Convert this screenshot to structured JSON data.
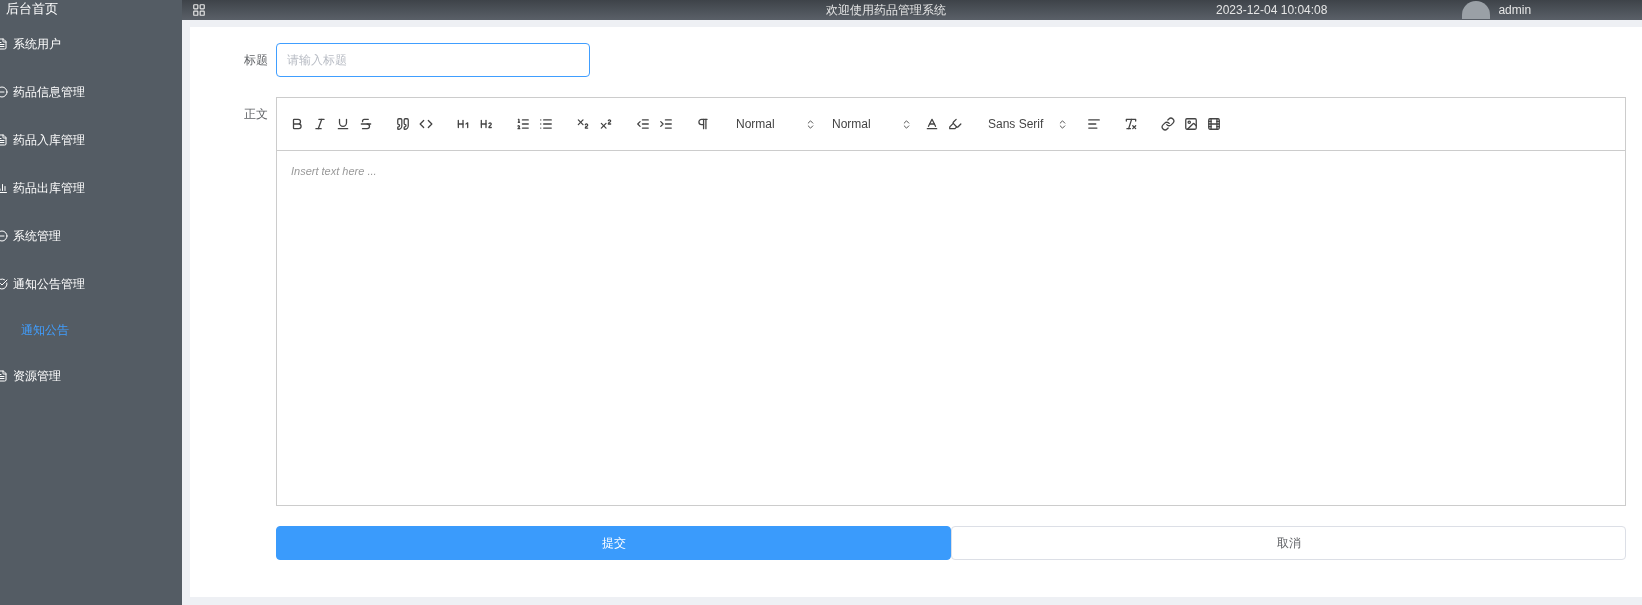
{
  "header": {
    "home": "后台首页",
    "welcome": "欢迎使用药品管理系统",
    "datetime": "2023-12-04 10:04:08",
    "user": "admin"
  },
  "sidebar": {
    "items": [
      {
        "label": "系统用户"
      },
      {
        "label": "药品信息管理"
      },
      {
        "label": "药品入库管理"
      },
      {
        "label": "药品出库管理"
      },
      {
        "label": "系统管理"
      },
      {
        "label": "通知公告管理",
        "children": [
          {
            "label": "通知公告",
            "selected": true
          }
        ]
      },
      {
        "label": "资源管理"
      }
    ]
  },
  "form": {
    "title_field": {
      "label": "标题",
      "placeholder": "请输入标题",
      "focused": true
    },
    "body_field": {
      "label": "正文",
      "pickers": [
        "Normal",
        "Normal",
        "Sans Serif"
      ],
      "placeholder": "Insert text here ..."
    },
    "buttons": [
      {
        "label": "提交",
        "kind": "primary"
      },
      {
        "label": "取消",
        "kind": "default"
      }
    ]
  }
}
